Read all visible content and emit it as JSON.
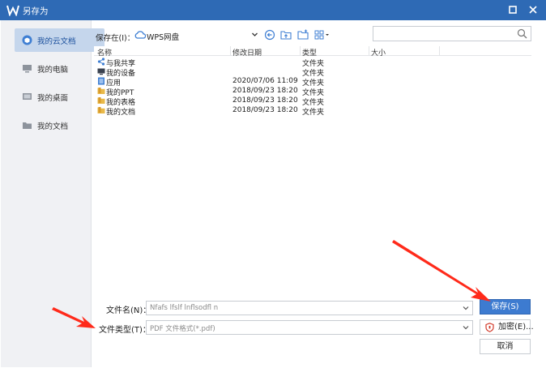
{
  "window": {
    "title": "另存为"
  },
  "sidebar": {
    "items": [
      {
        "label": "我的云文档",
        "icon": "cloud-doc-icon",
        "active": true
      },
      {
        "label": "我的电脑",
        "icon": "computer-icon",
        "active": false
      },
      {
        "label": "我的桌面",
        "icon": "desktop-icon",
        "active": false
      },
      {
        "label": "我的文档",
        "icon": "folder-icon",
        "active": false
      }
    ]
  },
  "toolbar": {
    "save_in_label": "保存在(I)：",
    "location": "WPS网盘",
    "search_placeholder": ""
  },
  "filelist": {
    "columns": [
      "名称",
      "修改日期",
      "类型",
      "大小"
    ],
    "rows": [
      {
        "name": "与我共享",
        "date": "",
        "type": "文件夹",
        "icon": "share-icon"
      },
      {
        "name": "我的设备",
        "date": "",
        "type": "文件夹",
        "icon": "device-icon"
      },
      {
        "name": "应用",
        "date": "2020/07/06 11:09",
        "type": "文件夹",
        "icon": "app-icon"
      },
      {
        "name": "我的PPT",
        "date": "2018/09/23 18:20",
        "type": "文件夹",
        "icon": "folder-icon"
      },
      {
        "name": "我的表格",
        "date": "2018/09/23 18:20",
        "type": "文件夹",
        "icon": "folder-icon"
      },
      {
        "name": "我的文档",
        "date": "2018/09/23 18:20",
        "type": "文件夹",
        "icon": "folder-icon"
      }
    ]
  },
  "form": {
    "filename_label": "文件名(N)：",
    "filename_value": "Nfafs lfslf lnflsodfl n",
    "filetype_label": "文件类型(T)：",
    "filetype_value": "PDF 文件格式(*.pdf)"
  },
  "buttons": {
    "save": "保存(S)",
    "encrypt": "加密(E)...",
    "cancel": "取消"
  },
  "colors": {
    "titlebar": "#2e6ab5",
    "primary_button": "#3d7bd0",
    "sidebar_active": "#c5d6ec",
    "annotation_arrow": "#ff2a1a"
  }
}
